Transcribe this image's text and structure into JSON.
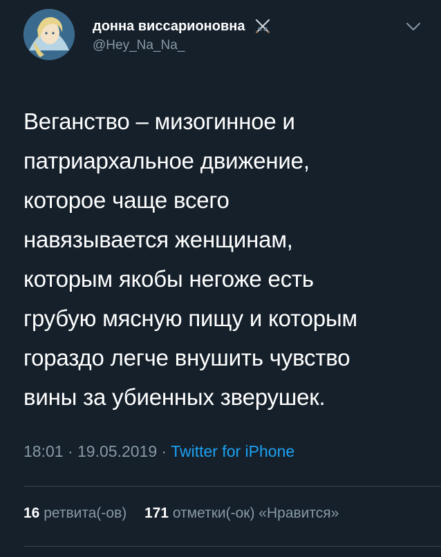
{
  "tweet": {
    "author_name": "донна виссарионовна",
    "author_handle": "@Hey_Na_Na_",
    "name_emoji": "crossed-swords-icon",
    "text": "Веганство – мизогинное и\nпатриархальное движение,\nкоторое чаще всего\nнавязывается женщинам,\nкоторым якобы негоже есть\nгрубую мясную пищу и которым\nгораздо легче внушить чувство\nвины за убиенных зверушек.",
    "time": "18:01",
    "separator": "·",
    "date": "19.05.2019",
    "source": "Twitter for iPhone"
  },
  "stats": {
    "retweets_count": "16",
    "retweets_label": "ретвита(-ов)",
    "likes_count": "171",
    "likes_label": "отметки(-ок) «Нравится»"
  },
  "colors": {
    "background": "#15202b",
    "text_primary": "#ffffff",
    "text_secondary": "#8899a6",
    "link": "#1da1f2",
    "divider": "#38444d"
  }
}
